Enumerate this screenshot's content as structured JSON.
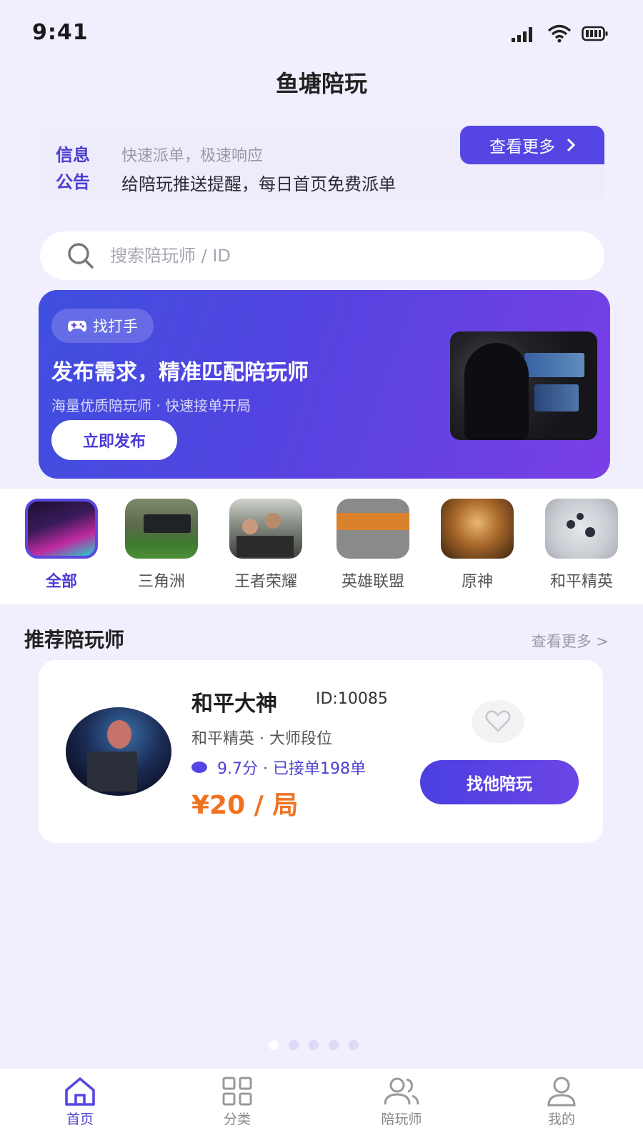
{
  "status_bar": {
    "time": "9:41"
  },
  "app_title": "鱼塘陪玩",
  "notice": {
    "label": "信息公告",
    "line1": "快速派单，极速响应",
    "line2": "给陪玩推送提醒，每日首页免费派单",
    "more_label": "查看更多"
  },
  "search": {
    "placeholder": "搜索陪玩师 / ID"
  },
  "banner": {
    "tag": "找打手",
    "title": "发布需求，精准匹配陪玩师",
    "subtitle": "海量优质陪玩师 · 快速接单开局",
    "button": "立即发布"
  },
  "categories": [
    {
      "label": "全部",
      "selected": true
    },
    {
      "label": "三角洲",
      "selected": false
    },
    {
      "label": "王者荣耀",
      "selected": false
    },
    {
      "label": "英雄联盟",
      "selected": false
    },
    {
      "label": "原神",
      "selected": false
    },
    {
      "label": "和平精英",
      "selected": false
    }
  ],
  "recommend": {
    "title": "推荐陪玩师",
    "more": "查看更多 >",
    "card": {
      "name": "和平大神",
      "id": "ID:10085",
      "game_rank": "和平精英 · 大师段位",
      "rating": "9.7分 · 已接单198单",
      "price": "¥20 / 局",
      "button": "找他陪玩"
    }
  },
  "tabs": [
    {
      "label": "首页",
      "active": true
    },
    {
      "label": "分类",
      "active": false
    },
    {
      "label": "陪玩师",
      "active": false
    },
    {
      "label": "我的",
      "active": false
    }
  ],
  "colors": {
    "accent": "#5546e3",
    "price": "#f07221",
    "background": "#f1eefd"
  }
}
